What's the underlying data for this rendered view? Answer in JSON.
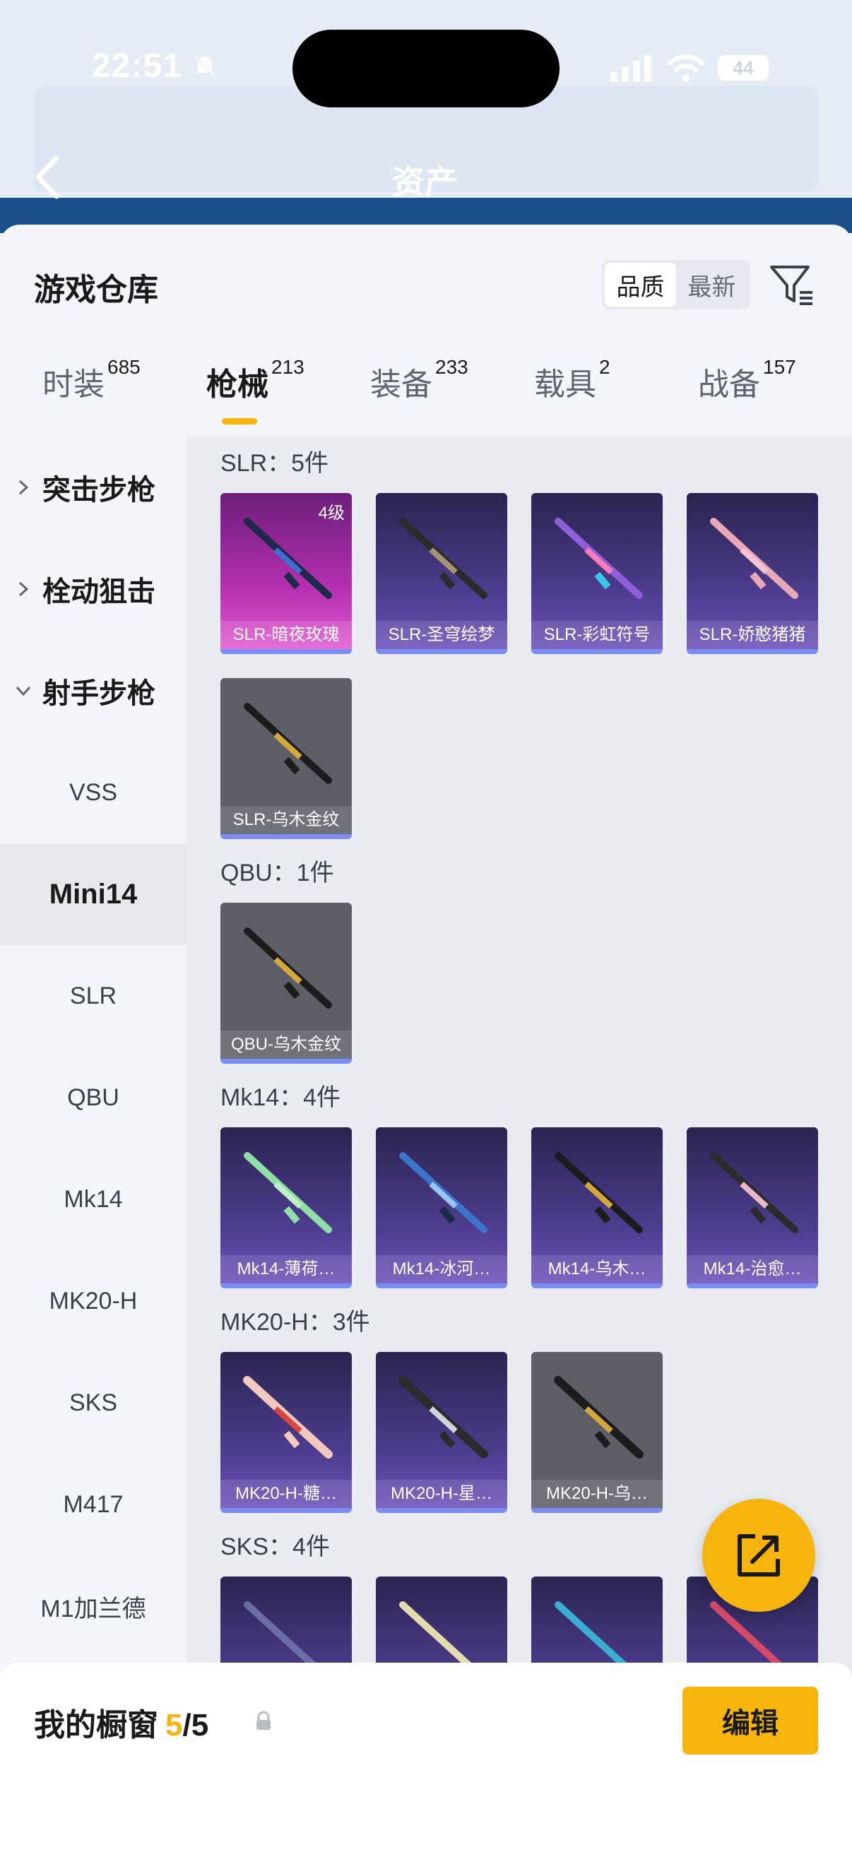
{
  "status": {
    "time": "22:51",
    "battery": "44"
  },
  "header": {
    "title": "资产"
  },
  "sheet": {
    "title": "游戏仓库",
    "sort_options": [
      "品质",
      "最新"
    ],
    "active_sort": "品质"
  },
  "tabs": [
    {
      "label": "时装",
      "count": "685"
    },
    {
      "label": "枪械",
      "count": "213"
    },
    {
      "label": "装备",
      "count": "233"
    },
    {
      "label": "载具",
      "count": "2"
    },
    {
      "label": "战备",
      "count": "157"
    }
  ],
  "categories": {
    "groups": [
      "突击步枪",
      "栓动狙击",
      "射手步枪"
    ],
    "items": [
      "VSS",
      "Mini14",
      "SLR",
      "QBU",
      "Mk14",
      "MK20-H",
      "SKS",
      "M417",
      "M1加兰德"
    ],
    "active": "Mini14"
  },
  "sections": [
    {
      "title": "SLR：5件",
      "items": [
        {
          "name": "SLR-暗夜玫瑰",
          "rank": "4级",
          "style": "pink"
        },
        {
          "name": "SLR-圣穹绘梦",
          "style": "purple"
        },
        {
          "name": "SLR-彩虹符号",
          "style": "purple"
        },
        {
          "name": "SLR-娇憨猪猪",
          "style": "purple"
        },
        {
          "name": "SLR-乌木金纹",
          "style": "gray"
        }
      ]
    },
    {
      "title": "QBU：1件",
      "items": [
        {
          "name": "QBU-乌木金纹",
          "style": "gray"
        }
      ]
    },
    {
      "title": "Mk14：4件",
      "items": [
        {
          "name": "Mk14-薄荷…",
          "style": "purple"
        },
        {
          "name": "Mk14-冰河…",
          "style": "purple"
        },
        {
          "name": "Mk14-乌木…",
          "style": "purple"
        },
        {
          "name": "Mk14-治愈…",
          "style": "purple"
        }
      ]
    },
    {
      "title": "MK20-H：3件",
      "items": [
        {
          "name": "MK20-H-糖…",
          "style": "purple"
        },
        {
          "name": "MK20-H-星…",
          "style": "purple"
        },
        {
          "name": "MK20-H-乌…",
          "style": "gray"
        }
      ]
    },
    {
      "title": "SKS：4件",
      "items": [
        {
          "name": "",
          "style": "purple"
        },
        {
          "name": "",
          "style": "purple"
        },
        {
          "name": "",
          "style": "purple"
        },
        {
          "name": "",
          "style": "purple"
        }
      ]
    }
  ],
  "showcase": {
    "label": "我的橱窗",
    "count": "5",
    "total": "/5",
    "edit_label": "编辑"
  },
  "colors": {
    "accent": "#f6b40d",
    "rare": "#7b8cf2"
  }
}
